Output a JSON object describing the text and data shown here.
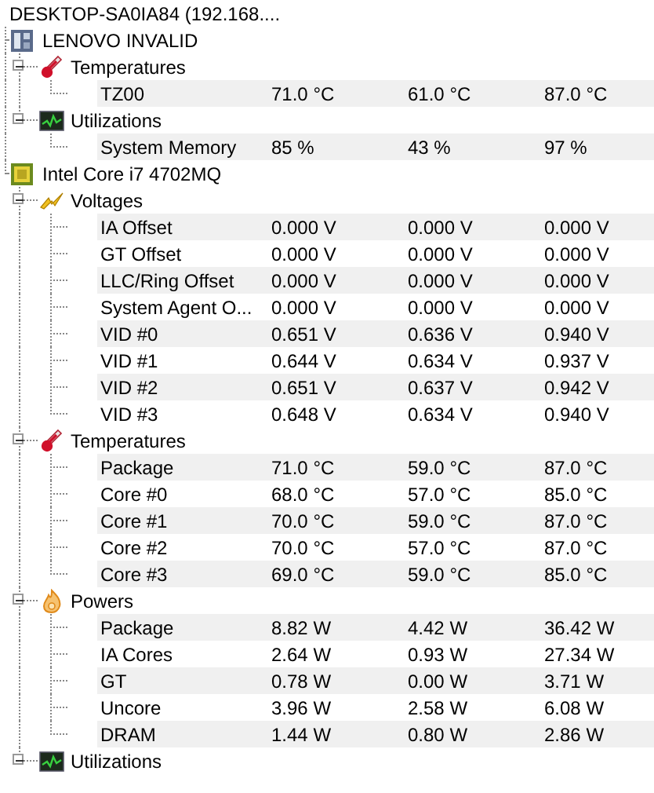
{
  "header": {
    "text": "DESKTOP-SA0IA84 (192.168...."
  },
  "devices": [
    {
      "name": "LENOVO INVALID",
      "kind": "board",
      "groups": [
        {
          "name": "Temperatures",
          "kind": "temperature",
          "expanded": true,
          "sensors": [
            {
              "name": "TZ00",
              "values": [
                "71.0 °C",
                "61.0 °C",
                "87.0 °C"
              ]
            }
          ]
        },
        {
          "name": "Utilizations",
          "kind": "utilization",
          "expanded": true,
          "sensors": [
            {
              "name": "System Memory",
              "values": [
                "85 %",
                "43 %",
                "97 %"
              ]
            }
          ]
        }
      ]
    },
    {
      "name": "Intel Core i7 4702MQ",
      "kind": "cpu",
      "groups": [
        {
          "name": "Voltages",
          "kind": "voltage",
          "expanded": true,
          "sensors": [
            {
              "name": "IA Offset",
              "values": [
                "0.000 V",
                "0.000 V",
                "0.000 V"
              ]
            },
            {
              "name": "GT Offset",
              "values": [
                "0.000 V",
                "0.000 V",
                "0.000 V"
              ]
            },
            {
              "name": "LLC/Ring Offset",
              "values": [
                "0.000 V",
                "0.000 V",
                "0.000 V"
              ]
            },
            {
              "name": "System Agent O...",
              "values": [
                "0.000 V",
                "0.000 V",
                "0.000 V"
              ]
            },
            {
              "name": "VID #0",
              "values": [
                "0.651 V",
                "0.636 V",
                "0.940 V"
              ]
            },
            {
              "name": "VID #1",
              "values": [
                "0.644 V",
                "0.634 V",
                "0.937 V"
              ]
            },
            {
              "name": "VID #2",
              "values": [
                "0.651 V",
                "0.637 V",
                "0.942 V"
              ]
            },
            {
              "name": "VID #3",
              "values": [
                "0.648 V",
                "0.634 V",
                "0.940 V"
              ]
            }
          ]
        },
        {
          "name": "Temperatures",
          "kind": "temperature",
          "expanded": true,
          "sensors": [
            {
              "name": "Package",
              "values": [
                "71.0 °C",
                "59.0 °C",
                "87.0 °C"
              ]
            },
            {
              "name": "Core #0",
              "values": [
                "68.0 °C",
                "57.0 °C",
                "85.0 °C"
              ]
            },
            {
              "name": "Core #1",
              "values": [
                "70.0 °C",
                "59.0 °C",
                "87.0 °C"
              ]
            },
            {
              "name": "Core #2",
              "values": [
                "70.0 °C",
                "57.0 °C",
                "87.0 °C"
              ]
            },
            {
              "name": "Core #3",
              "values": [
                "69.0 °C",
                "59.0 °C",
                "85.0 °C"
              ]
            }
          ]
        },
        {
          "name": "Powers",
          "kind": "power",
          "expanded": true,
          "sensors": [
            {
              "name": "Package",
              "values": [
                "8.82 W",
                "4.42 W",
                "36.42 W"
              ]
            },
            {
              "name": "IA Cores",
              "values": [
                "2.64 W",
                "0.93 W",
                "27.34 W"
              ]
            },
            {
              "name": "GT",
              "values": [
                "0.78 W",
                "0.00 W",
                "3.71 W"
              ]
            },
            {
              "name": "Uncore",
              "values": [
                "3.96 W",
                "2.58 W",
                "6.08 W"
              ]
            },
            {
              "name": "DRAM",
              "values": [
                "1.44 W",
                "0.80 W",
                "2.86 W"
              ]
            }
          ]
        },
        {
          "name": "Utilizations",
          "kind": "utilization",
          "expanded": true
        }
      ]
    }
  ]
}
